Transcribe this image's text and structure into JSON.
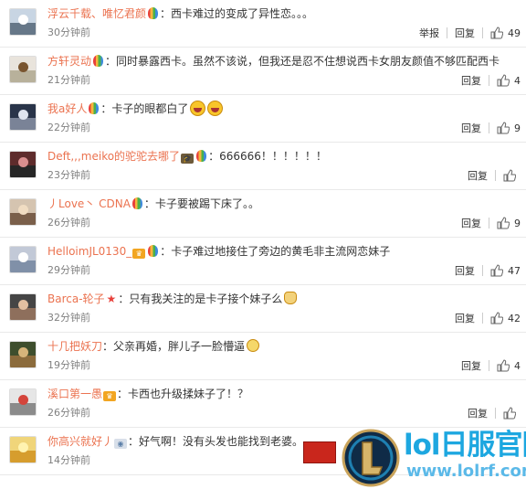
{
  "colors": {
    "username": "#eb7350",
    "time": "#808080",
    "watermark": "#1da7e0"
  },
  "comments": [
    {
      "user": "浮云千载、唯忆君颜",
      "badges": [
        "balloon-badge"
      ],
      "text": "西卡难过的变成了异性恋。。。",
      "time": "30分钟前",
      "report": "举报",
      "reply": "回复",
      "likes": "49"
    },
    {
      "user": "方轩灵动",
      "badges": [
        "balloon-badge"
      ],
      "text": "同时暴露西卡。虽然不该说，但我还是忍不住想说西卡女朋友颜值不够匹配西卡",
      "time": "21分钟前",
      "reply": "回复",
      "likes": "4"
    },
    {
      "user": "我a好人",
      "badges": [
        "balloon-badge"
      ],
      "text": "卡子的眼都白了",
      "emojis": [
        "laugh-emoji",
        "laugh-emoji"
      ],
      "time": "22分钟前",
      "reply": "回复",
      "likes": "9"
    },
    {
      "user": "Deft,,,meiko的驼驼去哪了",
      "badges": [
        "graduate-badge",
        "balloon-badge"
      ],
      "text": "666666！！！！！！",
      "time": "23分钟前",
      "reply": "回复",
      "likes": ""
    },
    {
      "user": "丿Love丶 CDNA",
      "badges": [
        "balloon-badge"
      ],
      "text": "卡子要被踢下床了。。",
      "time": "26分钟前",
      "reply": "回复",
      "likes": "9"
    },
    {
      "user": "HelloimJL0130_",
      "badges": [
        "vip-badge",
        "balloon-badge"
      ],
      "text": "卡子难过地接住了旁边的黄毛非主流网恋妹子",
      "time": "29分钟前",
      "reply": "回复",
      "likes": "47"
    },
    {
      "user": "Barca-轮子",
      "badges": [
        "star-badge"
      ],
      "text": "只有我关注的是卡子接个妹子么",
      "emojis": [
        "cat-emoji"
      ],
      "time": "32分钟前",
      "reply": "回复",
      "likes": "42"
    },
    {
      "user": "十几把妖刀",
      "badges": [],
      "text": "父亲再婚，胖儿子一脸懵逼",
      "emojis": [
        "pale-emoji"
      ],
      "time": "19分钟前",
      "reply": "回复",
      "likes": "4"
    },
    {
      "user": "溪口第一愚",
      "badges": [
        "vip-badge"
      ],
      "text": "卡西也升级揉妹子了！？",
      "time": "26分钟前",
      "reply": "回复",
      "likes": ""
    },
    {
      "user": "你高兴就好丿",
      "badges": [
        "swirl-badge"
      ],
      "text": "好气啊！没有头发也能找到老婆。",
      "time": "14分钟前",
      "reply": "",
      "likes": ""
    }
  ],
  "watermark": {
    "title": "lol日服官网",
    "url": "www.lolrf.com"
  }
}
